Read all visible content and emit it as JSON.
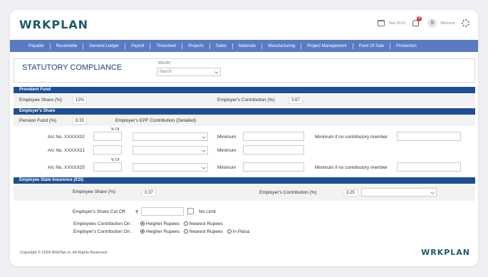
{
  "header": {
    "logo": "WRKPLAN",
    "year": "Year 24-25",
    "notifications": "8",
    "avatar_initial": "S",
    "welcome": "Welcome"
  },
  "nav": [
    "Payable",
    "Receivable",
    "General Ledger",
    "Payroll",
    "Timesheet",
    "Projects",
    "Sales",
    "Materials",
    "Manufacturing",
    "Project Management",
    "Point Of Sale",
    "Production"
  ],
  "page": {
    "title": "STATUTORY COMPLIANCE",
    "month_label": "Month:",
    "month_value": "March"
  },
  "provident_fund": {
    "section": "Provident Fund",
    "employee_share_label": "Employee Share (%)",
    "employee_share_value": "12%",
    "employer_contribution_label": "Employer's Contribution (%)",
    "employer_contribution_value": "3.67"
  },
  "employers_share": {
    "section": "Employer's Share",
    "pension_label": "Pension Fund (%)",
    "pension_value": "8.33",
    "epf_label": "Employer's EPF Contribution (Detailed)",
    "pct_of": "% Of",
    "minimum_label": "Minimum",
    "min_no_contrib_label": "Minimum if no contributory member",
    "accounts": [
      {
        "label": "A/c No. XXXXX02"
      },
      {
        "label": "A/c No. XXXXX21"
      },
      {
        "label": "A/c No. XXXXX25"
      }
    ]
  },
  "esi": {
    "section": "Employee State Insurence (ESI)",
    "employee_share_label": "Employee Share (%)",
    "employee_share_value": "0.37",
    "employer_contribution_label": "Employer's Contribution (%)",
    "employer_contribution_value": "3.25",
    "cutoff_label": "Employer's Share Cut Off",
    "rupee_symbol": "₹",
    "no_limit_label": "No Limit",
    "employees_contribution_on": "Employees Contribution On :",
    "employers_contribution_on": "Employer's Contribution On :",
    "higher_rupees": "Heigher Rupees",
    "nearest_rupees": "Nearest Rupees",
    "in_paisa": "In Paisa"
  },
  "footer": {
    "copyright": "Copyright © 2024 WrkPlan.in. All Rights Reserved.",
    "logo": "WRKPLAN"
  },
  "colors": {
    "nav_bg": "#5a7bc4",
    "section_bar": "#1e4f96",
    "brand": "#1e5a6a"
  }
}
